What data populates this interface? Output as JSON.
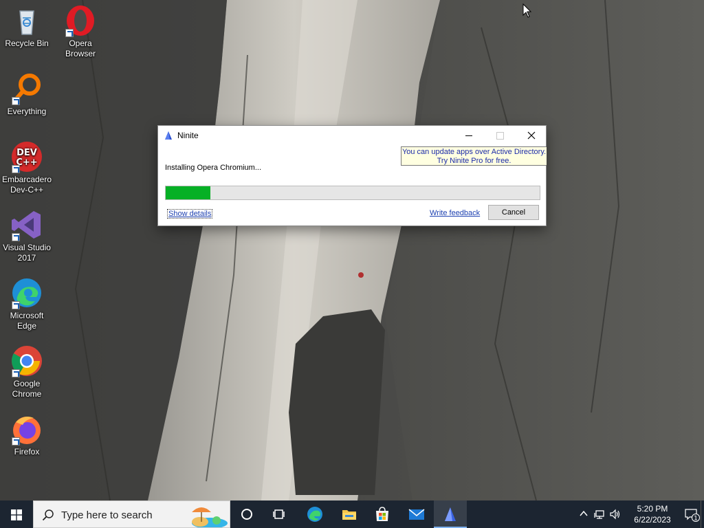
{
  "desktop": {
    "icons": [
      {
        "label": "Recycle Bin",
        "icon": "recycle-bin-icon"
      },
      {
        "label": "Opera Browser",
        "icon": "opera-icon"
      },
      {
        "label": "Everything",
        "icon": "everything-search-icon"
      },
      {
        "label": "Embarcadero Dev-C++",
        "icon": "devcpp-icon"
      },
      {
        "label": "Visual Studio 2017",
        "icon": "visual-studio-icon"
      },
      {
        "label": "Microsoft Edge",
        "icon": "edge-icon"
      },
      {
        "label": "Google Chrome",
        "icon": "chrome-icon"
      },
      {
        "label": "Firefox",
        "icon": "firefox-icon"
      }
    ]
  },
  "ninite": {
    "title": "Ninite",
    "promo_line1": "You can update apps over Active Directory.",
    "promo_line2": "Try Ninite Pro for free.",
    "status": "Installing Opera Chromium...",
    "progress": 0.12,
    "show_details": "Show details",
    "write_feedback": "Write feedback",
    "cancel": "Cancel",
    "progress_color": "#06b025"
  },
  "taskbar": {
    "search_placeholder": "Type here to search",
    "apps": [
      "cortana-icon",
      "task-view-icon",
      "edge-icon",
      "file-explorer-icon",
      "store-icon",
      "mail-icon",
      "ninite-icon"
    ],
    "time": "5:20 PM",
    "date": "6/22/2023",
    "notification_count": "1"
  }
}
